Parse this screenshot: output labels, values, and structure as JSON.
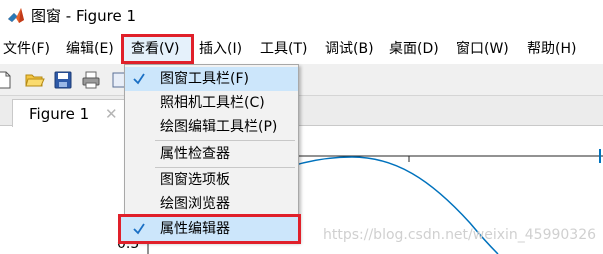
{
  "window": {
    "title": "图窗 - Figure 1"
  },
  "menubar": {
    "items": [
      {
        "label": "文件(F)"
      },
      {
        "label": "编辑(E)"
      },
      {
        "label": "查看(V)"
      },
      {
        "label": "插入(I)"
      },
      {
        "label": "工具(T)"
      },
      {
        "label": "调试(B)"
      },
      {
        "label": "桌面(D)"
      },
      {
        "label": "窗口(W)"
      },
      {
        "label": "帮助(H)"
      }
    ]
  },
  "tabs": [
    {
      "label": "Figure 1",
      "close": "✕"
    }
  ],
  "view_menu": {
    "items": [
      {
        "label": "图窗工具栏(F)",
        "checked": true
      },
      {
        "label": "照相机工具栏(C)",
        "checked": false
      },
      {
        "label": "绘图编辑工具栏(P)",
        "checked": false
      },
      {
        "label": "属性检查器",
        "checked": false
      },
      {
        "label": "图窗选项板",
        "checked": false
      },
      {
        "label": "绘图浏览器",
        "checked": false
      },
      {
        "label": "属性编辑器",
        "checked": true
      }
    ]
  },
  "axes": {
    "y_tick_label": "0.5"
  },
  "watermark": "https://blog.csdn.net/weixin_45990326",
  "colors": {
    "accent": "#0072bd",
    "highlight_border": "#e0202a"
  }
}
